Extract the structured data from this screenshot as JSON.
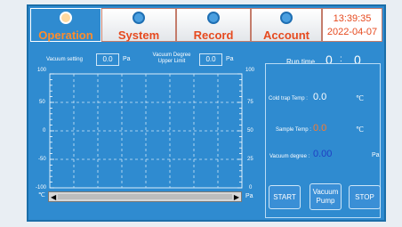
{
  "tabs": [
    {
      "label": "Operation",
      "icon": "gauge-icon",
      "active": true
    },
    {
      "label": "System",
      "icon": "gear-icon",
      "active": false
    },
    {
      "label": "Record",
      "icon": "document-icon",
      "active": false
    },
    {
      "label": "Account",
      "icon": "user-icon",
      "active": false
    }
  ],
  "clock": {
    "time": "13:39:35",
    "date": "2022-04-07"
  },
  "vacuum_setting": {
    "label": "Vacuum setting",
    "value": "0.0",
    "unit": "Pa"
  },
  "vacuum_upper": {
    "label_line1": "Vacuum Degree",
    "label_line2": "Upper Limit",
    "value": "0.0",
    "unit": "Pa"
  },
  "run_time": {
    "label": "Run time",
    "hours": "0",
    "sep": ":",
    "minutes": "0"
  },
  "chart": {
    "left_ticks": [
      "100",
      "50",
      "0",
      "-50",
      "-100"
    ],
    "left_unit": "℃",
    "right_ticks": [
      "100",
      "75",
      "50",
      "25",
      "0"
    ],
    "right_unit": "Pa"
  },
  "readings": {
    "cold_trap": {
      "label": "Cold trap Temp :",
      "value": "0.0",
      "unit": "℃"
    },
    "sample": {
      "label": "Sample Temp :",
      "value": "0.0",
      "unit": "℃"
    },
    "vacuum": {
      "label": "Vacuum degree :",
      "value": "0.00",
      "unit": "Pa"
    }
  },
  "buttons": {
    "start": "START",
    "vacuum_pump_1": "Vacuum",
    "vacuum_pump_2": "Pump",
    "stop": "STOP"
  },
  "colors": {
    "panel": "#2f8bd0",
    "accent": "#e64a1f",
    "sample_value": "#ff7a2a",
    "vacuum_value": "#1f3fc4"
  }
}
